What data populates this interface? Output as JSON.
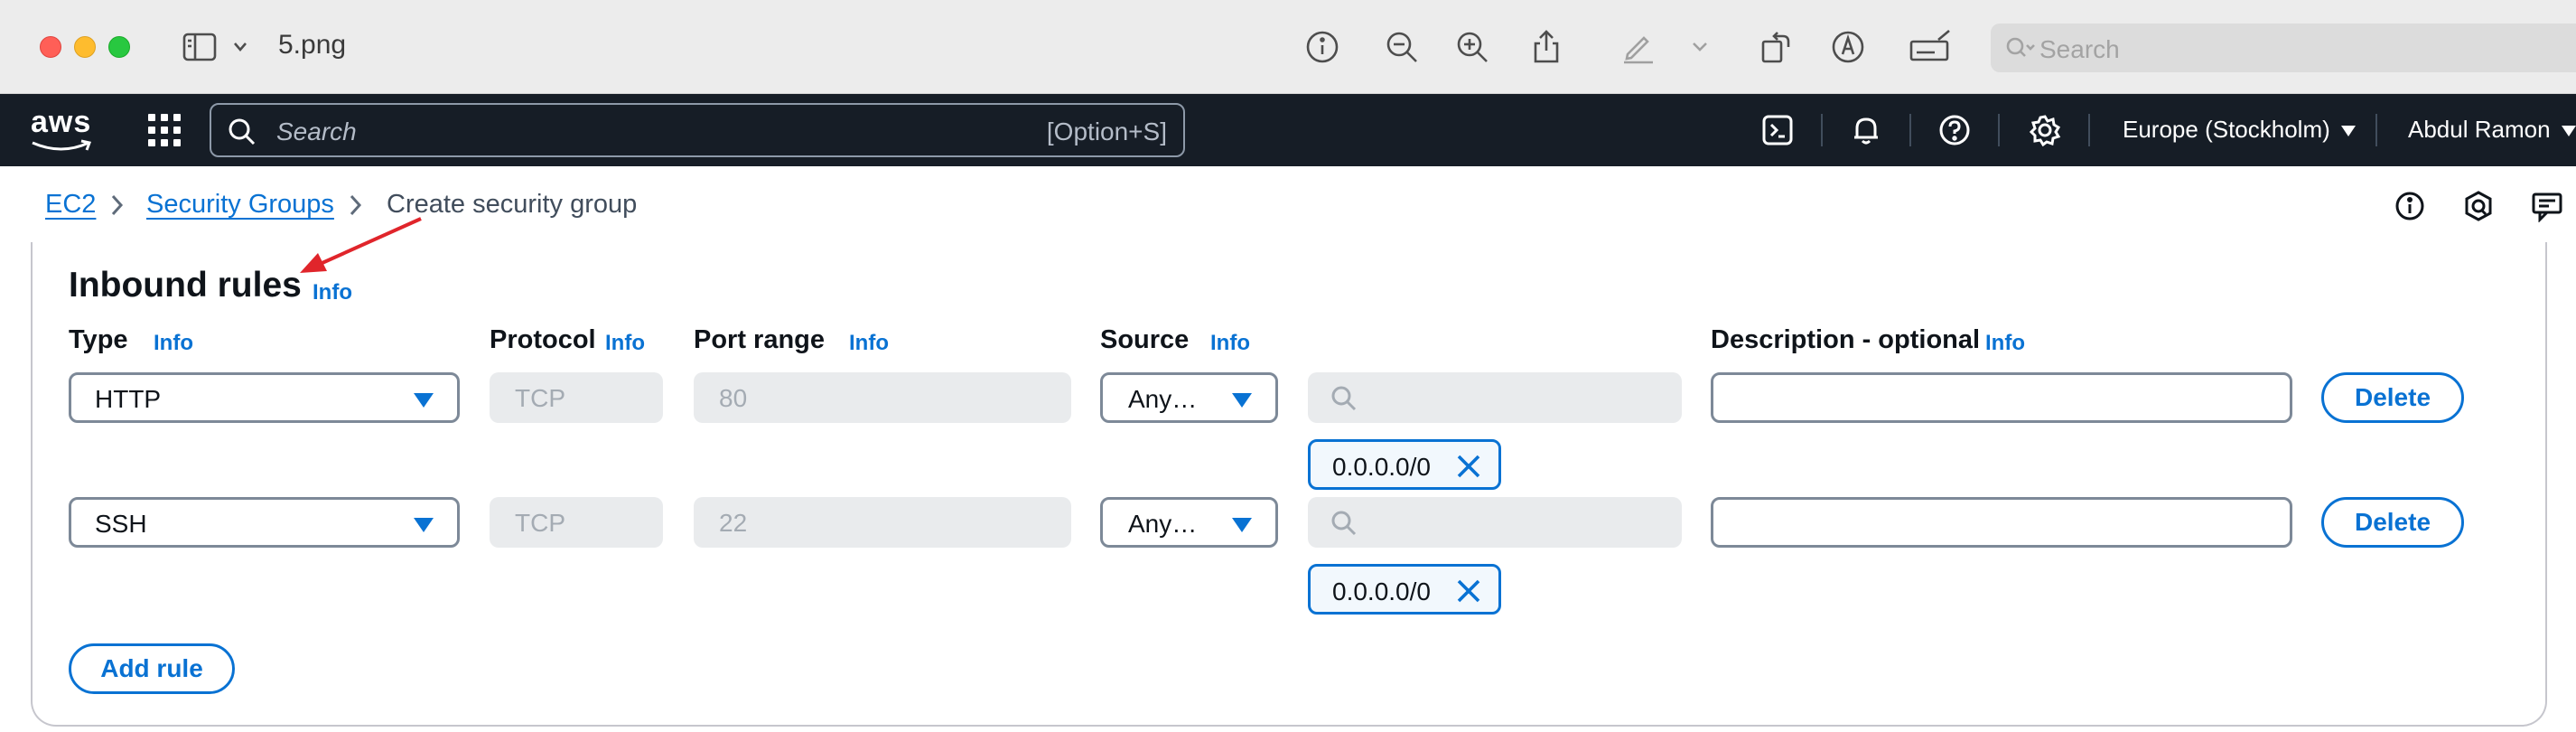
{
  "window": {
    "title": "5.png",
    "search_placeholder": "Search"
  },
  "aws_nav": {
    "logo": "aws",
    "search_placeholder": "Search",
    "search_shortcut": "[Option+S]",
    "region": "Europe (Stockholm)",
    "user": "Abdul Ramon"
  },
  "breadcrumb": {
    "items": [
      "EC2",
      "Security Groups"
    ],
    "current": "Create security group"
  },
  "inbound": {
    "title": "Inbound rules",
    "info_label": "Info",
    "columns": {
      "type": "Type",
      "protocol": "Protocol",
      "port_range": "Port range",
      "source": "Source",
      "description": "Description - optional"
    },
    "rules": [
      {
        "type": "HTTP",
        "protocol": "TCP",
        "port_range": "80",
        "source": "Any…",
        "cidr": "0.0.0.0/0",
        "description": "",
        "delete_label": "Delete"
      },
      {
        "type": "SSH",
        "protocol": "TCP",
        "port_range": "22",
        "source": "Any…",
        "cidr": "0.0.0.0/0",
        "description": "",
        "delete_label": "Delete"
      }
    ],
    "add_rule_label": "Add rule"
  },
  "colors": {
    "accent": "#0972d3",
    "nav_bg": "#161d26",
    "annotation_arrow": "#e0252b"
  }
}
